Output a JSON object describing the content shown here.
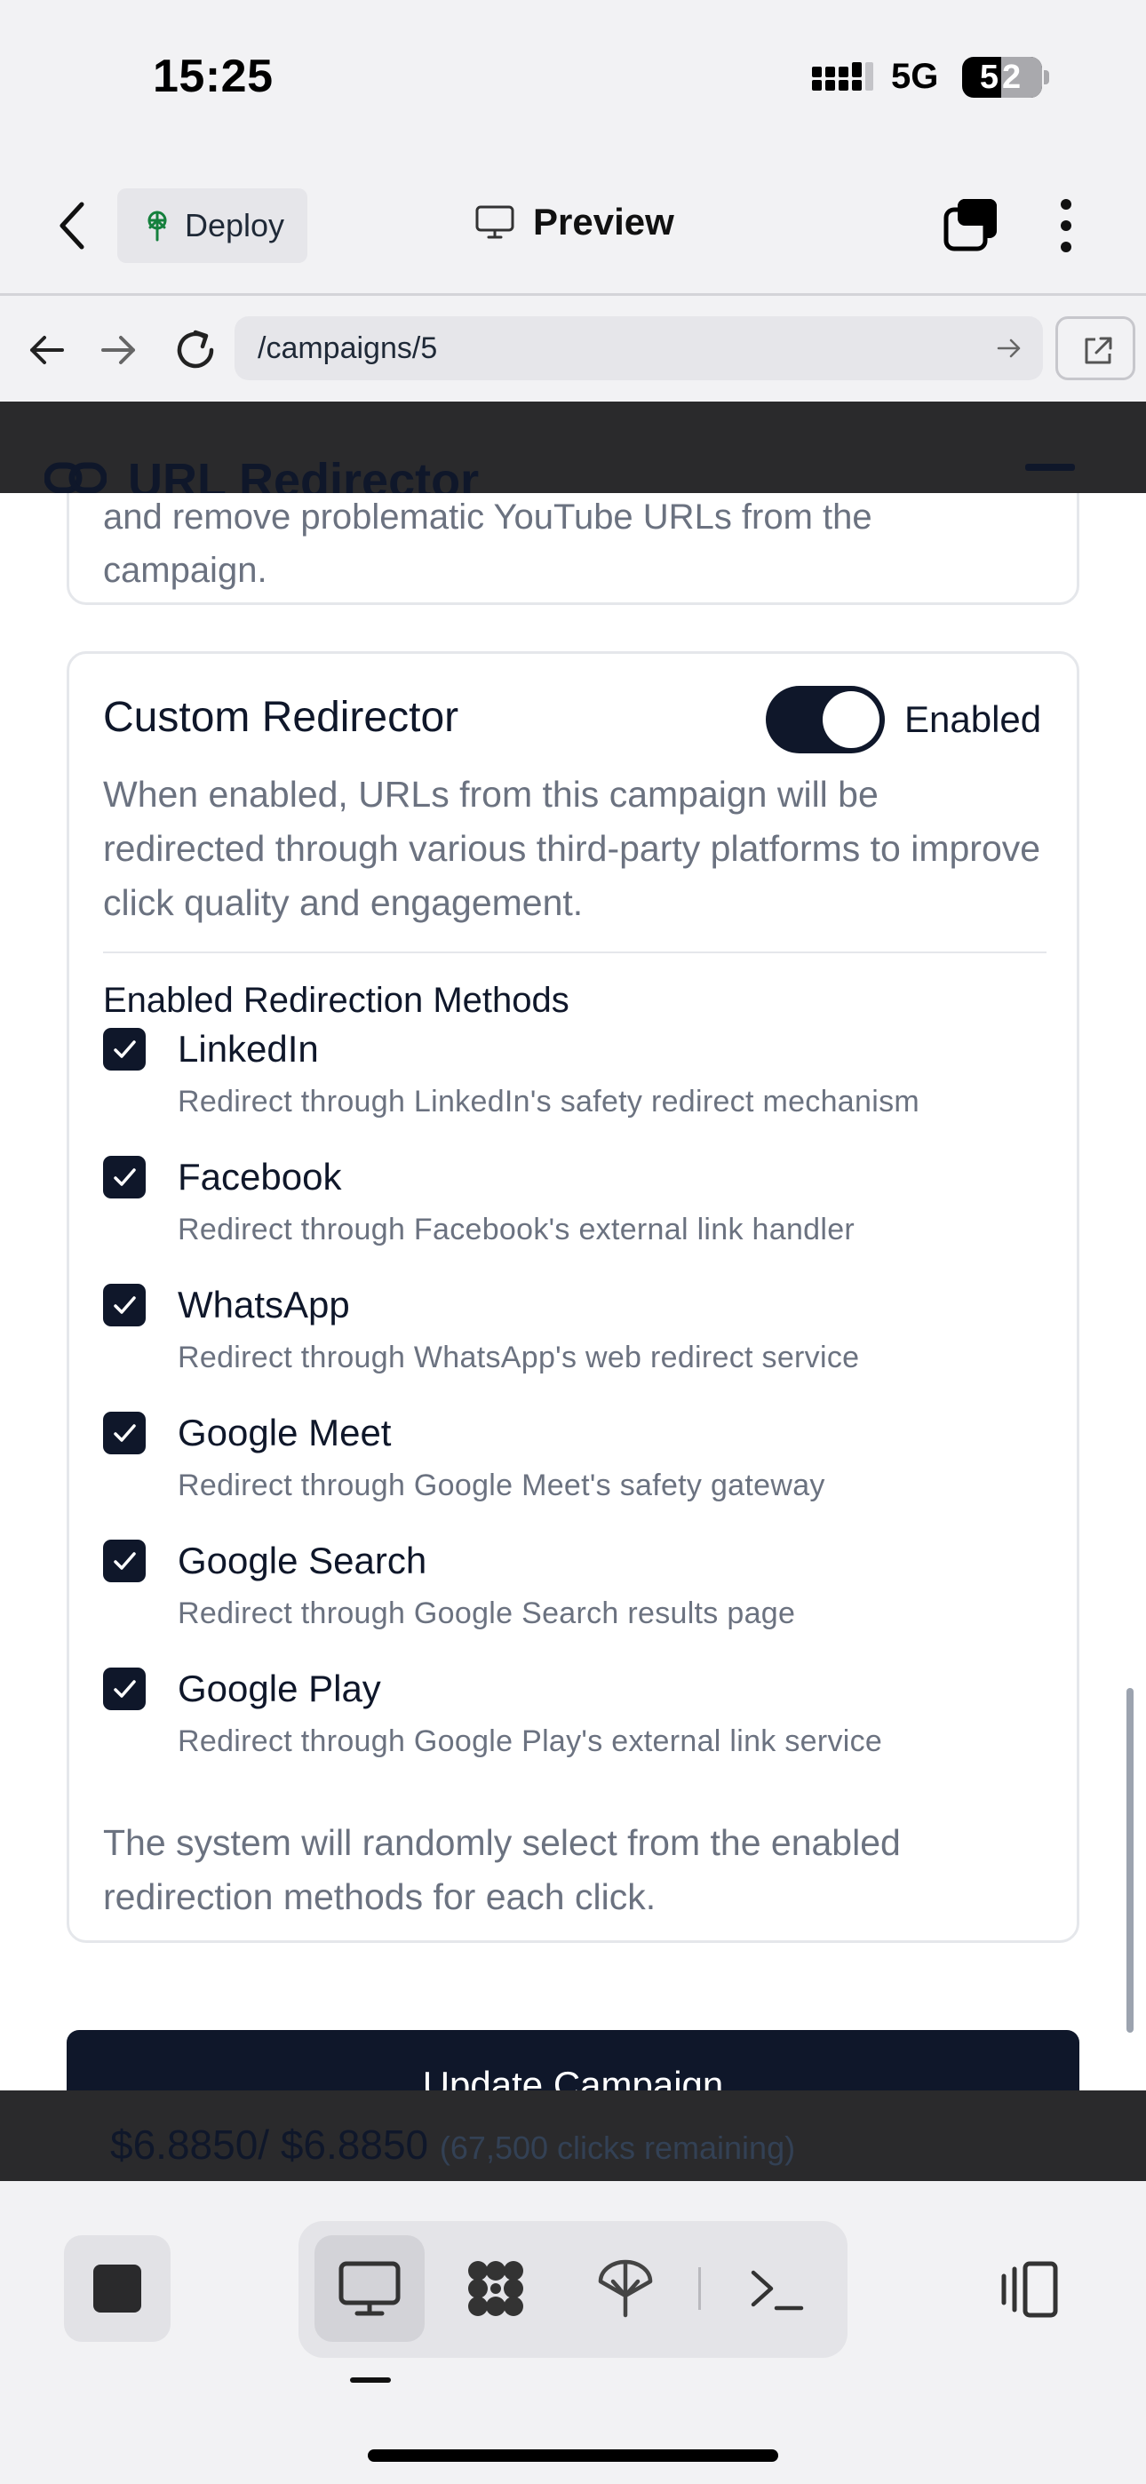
{
  "status_bar": {
    "time": "15:25",
    "network": "5G",
    "battery": "52"
  },
  "header": {
    "deploy_label": "Deploy",
    "preview_label": "Preview"
  },
  "browser": {
    "url": "/campaigns/5"
  },
  "app": {
    "title": "URL Redirector"
  },
  "prev_card": {
    "text": "and remove problematic YouTube URLs from the campaign."
  },
  "redirector": {
    "title": "Custom Redirector",
    "toggle_state": "Enabled",
    "toggle_on": true,
    "description": "When enabled, URLs from this campaign will be redirected through various third-party platforms to improve click quality and engagement.",
    "methods_title": "Enabled Redirection Methods",
    "methods": [
      {
        "name": "LinkedIn",
        "desc": "Redirect through LinkedIn's safety redirect mechanism",
        "checked": true
      },
      {
        "name": "Facebook",
        "desc": "Redirect through Facebook's external link handler",
        "checked": true
      },
      {
        "name": "WhatsApp",
        "desc": "Redirect through WhatsApp's web redirect service",
        "checked": true
      },
      {
        "name": "Google Meet",
        "desc": "Redirect through Google Meet's safety gateway",
        "checked": true
      },
      {
        "name": "Google Search",
        "desc": "Redirect through Google Search results page",
        "checked": true
      },
      {
        "name": "Google Play",
        "desc": "Redirect through Google Play's external link service",
        "checked": true
      }
    ],
    "footer": "The system will randomly select from the enabled redirection methods for each click."
  },
  "update_button": "Update Campaign",
  "budget": {
    "amount": "$6.8850/ $6.8850",
    "remaining": "(67,500 clicks remaining)"
  },
  "colors": {
    "primary": "#0f172a",
    "muted_text": "#6b7280",
    "border": "#e5e7eb",
    "chrome_bg": "#f2f2f4"
  }
}
